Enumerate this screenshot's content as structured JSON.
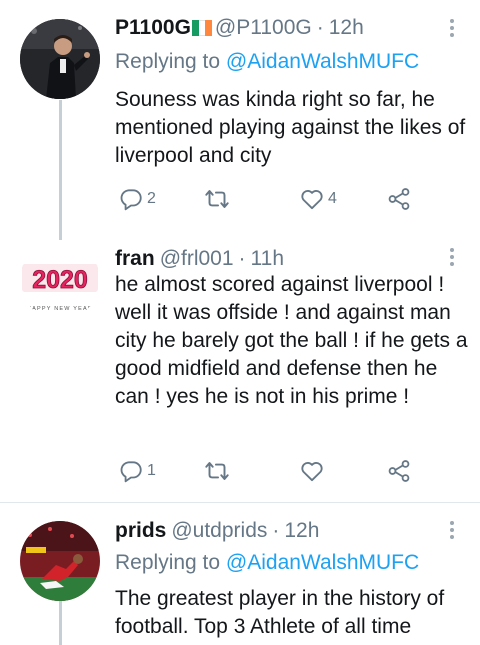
{
  "tweets": [
    {
      "name": "P1100G",
      "handle": "@P1100G",
      "separator": "·",
      "time": "12h",
      "reply_prefix": "Replying to ",
      "reply_to": "@AidanWalshMUFC",
      "text": "Souness was kinda right so far, he mentioned playing against the likes of liverpool and city",
      "replies": "2",
      "retweets": "",
      "likes": "4",
      "flag_colors": [
        "#169b62",
        "#ffffff",
        "#ff883e"
      ]
    },
    {
      "name": "fran",
      "handle": "@frl001",
      "separator": "·",
      "time": "11h",
      "avatar_title": "2020",
      "avatar_subtitle": "HAPPY NEW YEAR",
      "text": "he almost scored against liverpool ! well it was offside ! and against man city he barely got the ball ! if he gets a good midfield and defense then he can ! yes he is not in his prime !",
      "replies": "1",
      "retweets": "",
      "likes": ""
    },
    {
      "name": "prids",
      "handle": "@utdprids",
      "separator": "·",
      "time": "12h",
      "reply_prefix": "Replying to ",
      "reply_to": "@AidanWalshMUFC",
      "text": "The greatest player in the history of football. Top 3 Athlete of all time"
    }
  ],
  "icons": {
    "reply": "reply-icon",
    "retweet": "retweet-icon",
    "like": "heart-icon",
    "share": "share-icon",
    "menu": "more-options-icon"
  },
  "colors": {
    "link": "#1da1f2",
    "secondary_text": "#657786",
    "primary_text": "#14171a",
    "thread_line": "#c4cfd6",
    "divider": "#e1e8ed"
  }
}
